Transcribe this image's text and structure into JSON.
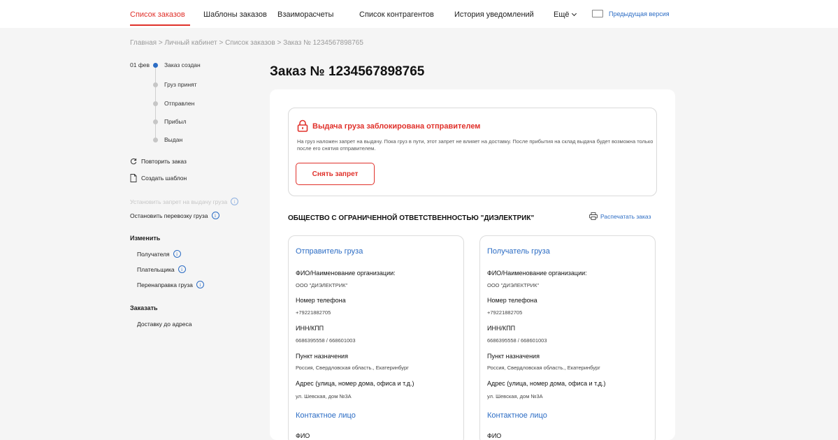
{
  "nav": {
    "items": [
      "Список заказов",
      "Шаблоны заказов",
      "Взаиморасчеты",
      "Список контрагентов",
      "История уведомлений",
      "Ещё"
    ],
    "prev_version": "Предыдущая версия",
    "accent": "#e0312b",
    "link_color": "#2b6cc4"
  },
  "breadcrumb": "Главная > Личный кабинет > Список заказов > Заказ № 1234567898765",
  "timeline": {
    "date": "01 фев",
    "steps": [
      "Заказ создан",
      "Груз принят",
      "Отправлен",
      "Прибыл",
      "Выдан"
    ]
  },
  "sidebar": {
    "repeat": "Повторить заказ",
    "template": "Создать шаблон",
    "ban": "Установить запрет на выдачу груза",
    "stop": "Остановить перевозку груза",
    "change_title": "Изменить",
    "change_items": [
      "Получателя",
      "Плательщика",
      "Перенаправка груза"
    ],
    "order_title": "Заказать",
    "order_items": [
      "Доставку до адреса"
    ]
  },
  "page_title": "Заказ № 1234567898765",
  "alert": {
    "title": "Выдача груза заблокирована отправителем",
    "text": "На груз наложен запрет на выдачу. Пока груз в пути, этот запрет не влияет на доставку. После прибытия на склад выдача будет возможна только после его снятия отправителем.",
    "button": "Снять запрет"
  },
  "company": "ОБЩЕСТВО С ОГРАНИЧЕННОЙ ОТВЕТСТВЕННОСТЬЮ \"ДИЭЛЕКТРИК\"",
  "print": "Распечатать заказ",
  "sender": {
    "title": "Отправитель груза",
    "name_label": "ФИО/Наименование организации:",
    "name": "ООО \"ДИЭЛЕКТРИК\"",
    "phone_label": "Номер телефона",
    "phone": "+79221882705",
    "inn_label": "ИНН/КПП",
    "inn": "6686395558 / 668601003",
    "point_label": "Пункт назначения",
    "point": "Россия, Свердловская область., Екатеринбург",
    "address_label": "Адрес (улица, номер дома, офиса и т.д.)",
    "address": "ул. Шевская, дом №3А",
    "contact_title": "Контактное лицо",
    "fio_label": "ФИО"
  },
  "receiver": {
    "title": "Получатель груза",
    "name_label": "ФИО/Наименование организации:",
    "name": "ООО \"ДИЭЛЕКТРИК\"",
    "phone_label": "Номер телефона",
    "phone": "+79221882705",
    "inn_label": "ИНН/КПП",
    "inn": "6686395558 / 668601003",
    "point_label": "Пункт назначения",
    "point": "Россия, Свердловская область., Екатеринбург",
    "address_label": "Адрес (улица, номер дома, офиса и т.д.)",
    "address": "ул. Шевская, дом №3А",
    "contact_title": "Контактное лицо",
    "fio_label": "ФИО"
  }
}
